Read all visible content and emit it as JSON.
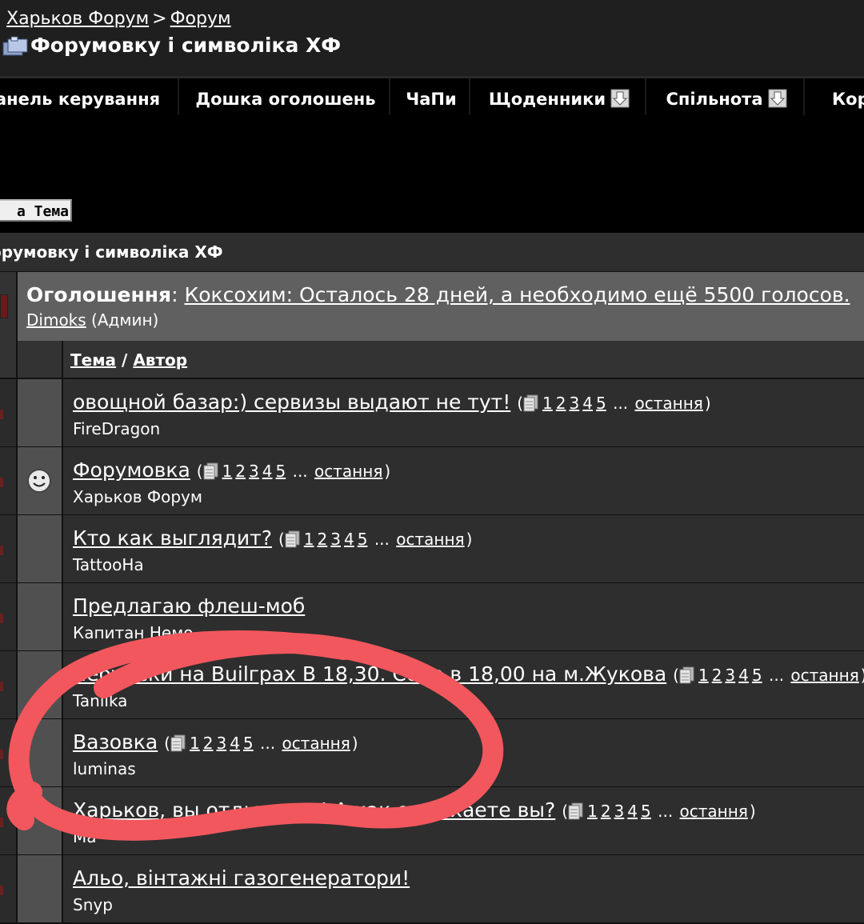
{
  "breadcrumb": {
    "home": "Харьков Форум",
    "separator": ">",
    "forum": "Форум"
  },
  "forum_title": "Форумовку і символіка ХФ",
  "nav": [
    {
      "label": "анель керування"
    },
    {
      "label": "Дошка оголошень"
    },
    {
      "label": "ЧаПи"
    },
    {
      "label": "Щоденники",
      "icon": "download-arrow-icon"
    },
    {
      "label": "Спільнота",
      "icon": "download-arrow-icon"
    },
    {
      "label": "Кор"
    }
  ],
  "new_topic_button": "а Тема",
  "section_title": "орумовку і символіка ХФ",
  "announcement": {
    "label": "Оголошення",
    "colon": ":",
    "text": "Коксохим: Осталось 28 дней, а необходимо ещё 5500 голосов.",
    "author": "Dimoks",
    "role": "(Админ)"
  },
  "table_header": {
    "topic": "Тема",
    "slash": "/",
    "author": "Автор"
  },
  "pages_labels": {
    "p1": "1",
    "p2": "2",
    "p3": "3",
    "p4": "4",
    "p5": "5",
    "ellipsis": "...",
    "last": "остання"
  },
  "topics": [
    {
      "title": "овощной базар:) сервизы выдают не тут!",
      "author": "FireDragon",
      "has_pages": true,
      "icon": ""
    },
    {
      "title": "Форумовка",
      "author": "Харьков Форум",
      "has_pages": true,
      "icon": "smiley-icon"
    },
    {
      "title": "Кто как выглядит?",
      "author": "TattooHa",
      "has_pages": true,
      "icon": ""
    },
    {
      "title": "Предлагаю флеш-моб",
      "author": "Капитан Немо",
      "has_pages": false,
      "icon": ""
    },
    {
      "title": "Чебуреки на Builграх В 18,30. Сбор в 18,00 на м.Жукова",
      "author": "Taniika",
      "has_pages": true,
      "icon": ""
    },
    {
      "title": "Вазовка",
      "author": "luminas",
      "has_pages": true,
      "icon": ""
    },
    {
      "title": "Харьков, вы отдыхаете! А как отдыхаете вы?",
      "author": "Ma",
      "has_pages": true,
      "icon": ""
    },
    {
      "title": "Альо, вінтажні газогенератори!",
      "author": "Snyp",
      "has_pages": false,
      "icon": ""
    }
  ],
  "annotation": {
    "color": "#f2575d"
  }
}
